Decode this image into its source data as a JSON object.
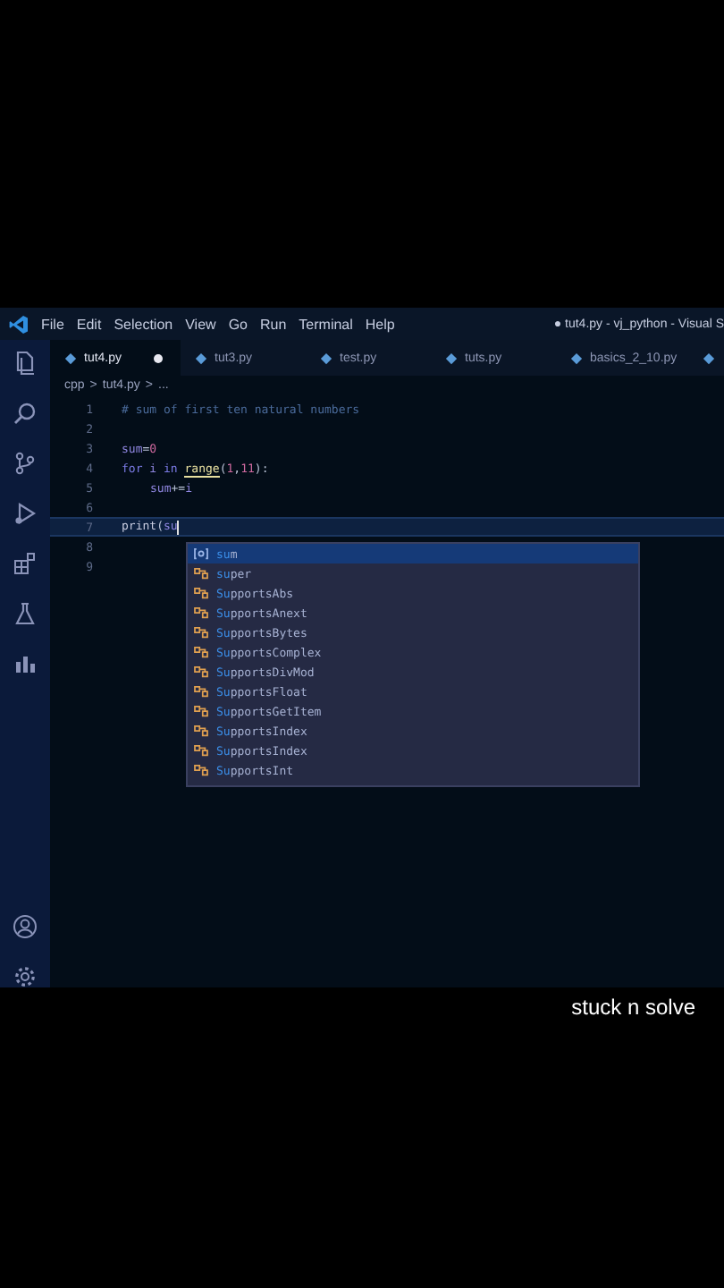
{
  "menu": [
    "File",
    "Edit",
    "Selection",
    "View",
    "Go",
    "Run",
    "Terminal",
    "Help"
  ],
  "window": {
    "title": "● tut4.py - vj_python - Visual S"
  },
  "tabs": [
    {
      "label": "tut4.py",
      "selected": true,
      "modified": true
    },
    {
      "label": "tut3.py",
      "selected": false,
      "modified": false
    },
    {
      "label": "test.py",
      "selected": false,
      "modified": false
    },
    {
      "label": "tuts.py",
      "selected": false,
      "modified": false
    },
    {
      "label": "basics_2_10.py",
      "selected": false,
      "modified": false
    }
  ],
  "breadcrumb": [
    "cpp",
    ">",
    "tut4.py",
    ">",
    "..."
  ],
  "code": [
    {
      "number": "1",
      "tokens": [
        {
          "kind": "comment",
          "text": "# sum of first ten natural numbers"
        }
      ]
    },
    {
      "number": "2"
    },
    {
      "number": "3",
      "tokens": [
        {
          "kind": "var",
          "text": "sum"
        },
        {
          "kind": "op",
          "text": "="
        },
        {
          "kind": "num",
          "text": "0"
        }
      ]
    },
    {
      "number": "4",
      "tokens": [
        {
          "kind": "kw",
          "text": "for"
        },
        {
          "kind": "var",
          "text": " i "
        },
        {
          "kind": "kw",
          "text": "in "
        },
        {
          "kind": "fn",
          "text": "range"
        },
        {
          "kind": "op",
          "text": "("
        },
        {
          "kind": "num",
          "text": "1"
        },
        {
          "kind": "op",
          "text": ","
        },
        {
          "kind": "num",
          "text": "11"
        },
        {
          "kind": "op",
          "text": "):"
        }
      ]
    },
    {
      "number": "5",
      "indented": true,
      "tokens": [
        {
          "kind": "var",
          "text": "sum"
        },
        {
          "kind": "op",
          "text": "+="
        },
        {
          "kind": "var",
          "text": "i"
        }
      ]
    },
    {
      "number": "6"
    },
    {
      "number": "7",
      "current": true,
      "tokens": [
        {
          "kind": "plain",
          "text": "print"
        },
        {
          "kind": "op",
          "text": "("
        },
        {
          "kind": "var",
          "text": "su"
        }
      ]
    },
    {
      "number": "8"
    },
    {
      "number": "9"
    }
  ],
  "suggestions": [
    {
      "kind": "variable",
      "match": "su",
      "rest": "m",
      "selected": true
    },
    {
      "kind": "class",
      "match": "su",
      "rest": "per",
      "selected": false
    },
    {
      "kind": "class",
      "match": "Su",
      "rest": "pportsAbs",
      "selected": false
    },
    {
      "kind": "class",
      "match": "Su",
      "rest": "pportsAnext",
      "selected": false
    },
    {
      "kind": "class",
      "match": "Su",
      "rest": "pportsBytes",
      "selected": false
    },
    {
      "kind": "class",
      "match": "Su",
      "rest": "pportsComplex",
      "selected": false
    },
    {
      "kind": "class",
      "match": "Su",
      "rest": "pportsDivMod",
      "selected": false
    },
    {
      "kind": "class",
      "match": "Su",
      "rest": "pportsFloat",
      "selected": false
    },
    {
      "kind": "class",
      "match": "Su",
      "rest": "pportsGetItem",
      "selected": false
    },
    {
      "kind": "class",
      "match": "Su",
      "rest": "pportsIndex",
      "selected": false
    },
    {
      "kind": "class",
      "match": "Su",
      "rest": "pportsIndex",
      "selected": false
    },
    {
      "kind": "class",
      "match": "Su",
      "rest": "pportsInt",
      "selected": false
    }
  ],
  "caption": "stuck n solve"
}
